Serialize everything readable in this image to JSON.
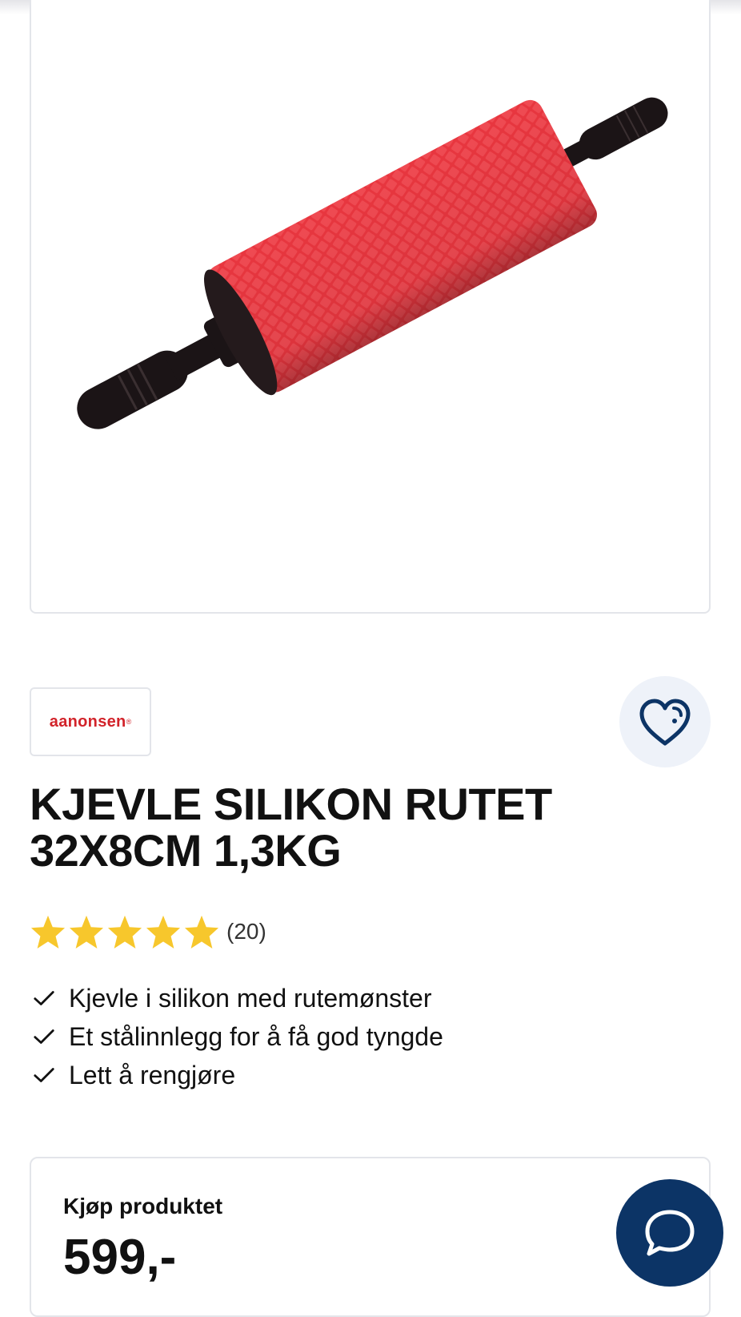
{
  "product": {
    "image_alt": "Kjevle silikon rutet",
    "brand": "aanonsen",
    "brand_mark": "®",
    "title": "KJEVLE SILIKON RUTET 32X8CM 1,3KG",
    "rating": {
      "stars": 5,
      "max": 5,
      "count_text": "(20)"
    },
    "features": [
      "Kjevle i silikon med rutemønster",
      "Et stålinnlegg for å få god tyngde",
      "Lett å rengjøre"
    ]
  },
  "buy": {
    "label": "Kjøp produktet",
    "price": "599,-"
  },
  "colors": {
    "accent": "#0c3466",
    "brand_red": "#d2232a",
    "star": "#f7c72c",
    "roller": "#e8363f"
  },
  "icons": {
    "favorite": "heart-icon",
    "chat": "chat-bubble-icon",
    "check": "check-icon",
    "star": "star-icon"
  }
}
